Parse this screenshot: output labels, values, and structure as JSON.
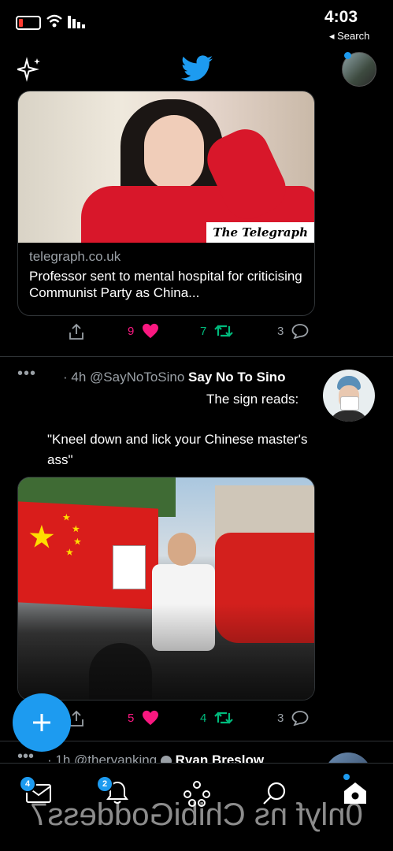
{
  "status": {
    "time": "4:03",
    "back_label": "◂ Search"
  },
  "tweet1": {
    "card_domain": "telegraph.co.uk",
    "card_title": "Professor sent to mental hospital for criticising Communist Party as China...",
    "card_badge": "The Telegraph",
    "counts": {
      "reply": "3",
      "retweet": "7",
      "like": "9"
    }
  },
  "tweet2": {
    "name": "Say No To Sino",
    "handle": "@SayNoToSino",
    "time": "· 4h",
    "text1": "The sign reads:",
    "text2": "\"Kneel down and lick your Chinese master's ass\"",
    "counts": {
      "reply": "3",
      "retweet": "4",
      "like": "5"
    }
  },
  "tweet3": {
    "name": "Ryan Breslow",
    "handle": "@theryanking",
    "time": "· 1h"
  },
  "tabbar": {
    "messages_badge": "4",
    "notifications_badge": "2"
  },
  "watermark": "0nlyf ns ChibiGoddess7",
  "colors": {
    "accent": "#1d9bf0",
    "like": "#f91880",
    "retweet": "#00ba7c"
  }
}
